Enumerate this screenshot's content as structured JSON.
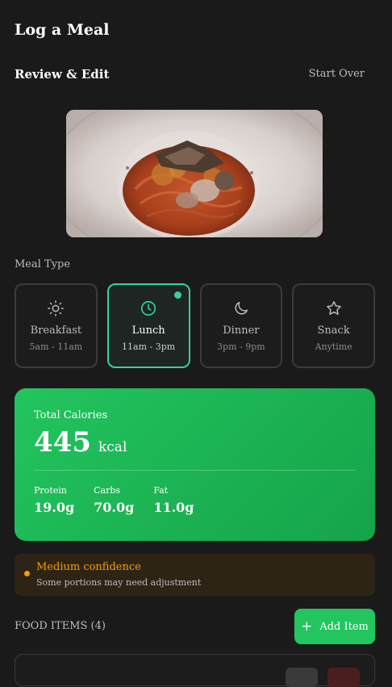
{
  "header": {
    "title": "Log a Meal"
  },
  "review": {
    "heading": "Review & Edit",
    "start_over": "Start Over"
  },
  "meal_type": {
    "label": "Meal Type",
    "options": [
      {
        "name": "Breakfast",
        "time": "5am - 11am",
        "icon": "sun-icon",
        "selected": false
      },
      {
        "name": "Lunch",
        "time": "11am - 3pm",
        "icon": "clock-icon",
        "selected": true
      },
      {
        "name": "Dinner",
        "time": "3pm - 9pm",
        "icon": "moon-icon",
        "selected": false
      },
      {
        "name": "Snack",
        "time": "Anytime",
        "icon": "star-icon",
        "selected": false
      }
    ]
  },
  "calories": {
    "label": "Total Calories",
    "value": "445",
    "unit": "kcal",
    "macros": [
      {
        "label": "Protein",
        "value": "19.0g"
      },
      {
        "label": "Carbs",
        "value": "70.0g"
      },
      {
        "label": "Fat",
        "value": "11.0g"
      }
    ]
  },
  "confidence": {
    "title": "Medium confidence",
    "subtitle": "Some portions may need adjustment"
  },
  "food_items": {
    "header": "FOOD ITEMS (4)",
    "add_label": "Add Item"
  },
  "colors": {
    "accent": "#22c55e",
    "selected_border": "#34d399",
    "warning": "#f59e0b",
    "background": "#1a1a1a"
  }
}
